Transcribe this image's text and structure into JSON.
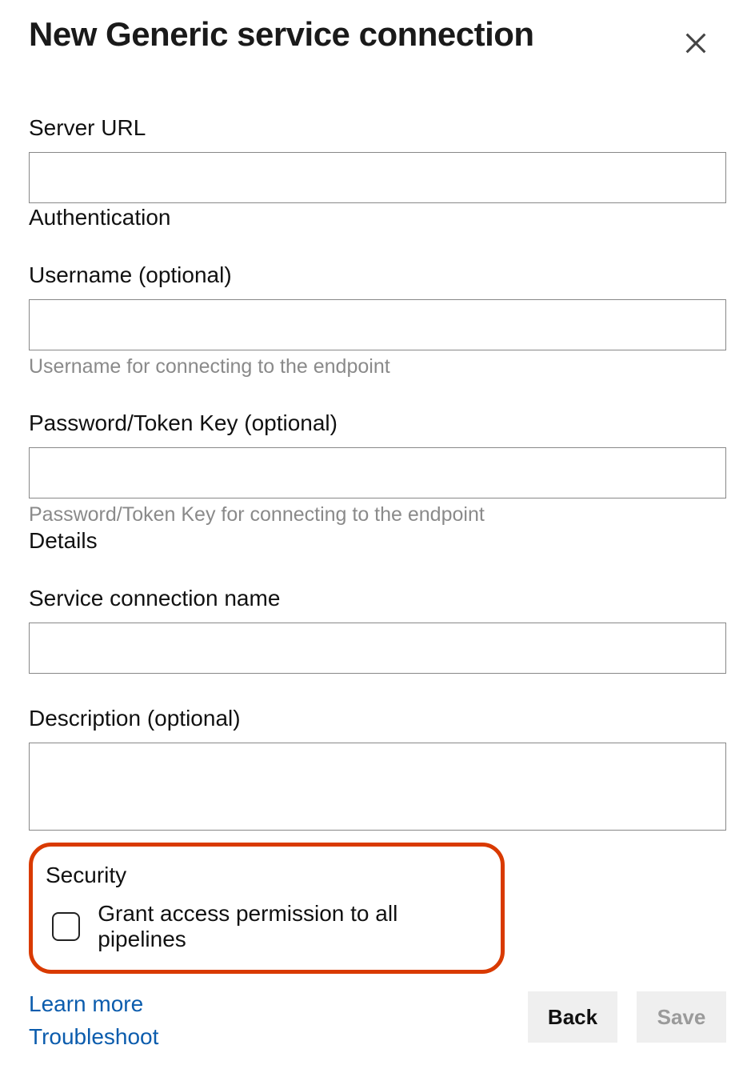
{
  "header": {
    "title": "New Generic service connection"
  },
  "fields": {
    "server_url": {
      "label": "Server URL",
      "value": ""
    },
    "auth_section": "Authentication",
    "username": {
      "label": "Username (optional)",
      "value": "",
      "help": "Username for connecting to the endpoint"
    },
    "password": {
      "label": "Password/Token Key (optional)",
      "value": "",
      "help": "Password/Token Key for connecting to the endpoint"
    },
    "details_section": "Details",
    "conn_name": {
      "label": "Service connection name",
      "value": ""
    },
    "description": {
      "label": "Description (optional)",
      "value": ""
    }
  },
  "security": {
    "heading": "Security",
    "checkbox_label": "Grant access permission to all pipelines",
    "checked": false
  },
  "footer": {
    "learn_more": "Learn more",
    "troubleshoot": "Troubleshoot",
    "back": "Back",
    "save": "Save"
  }
}
